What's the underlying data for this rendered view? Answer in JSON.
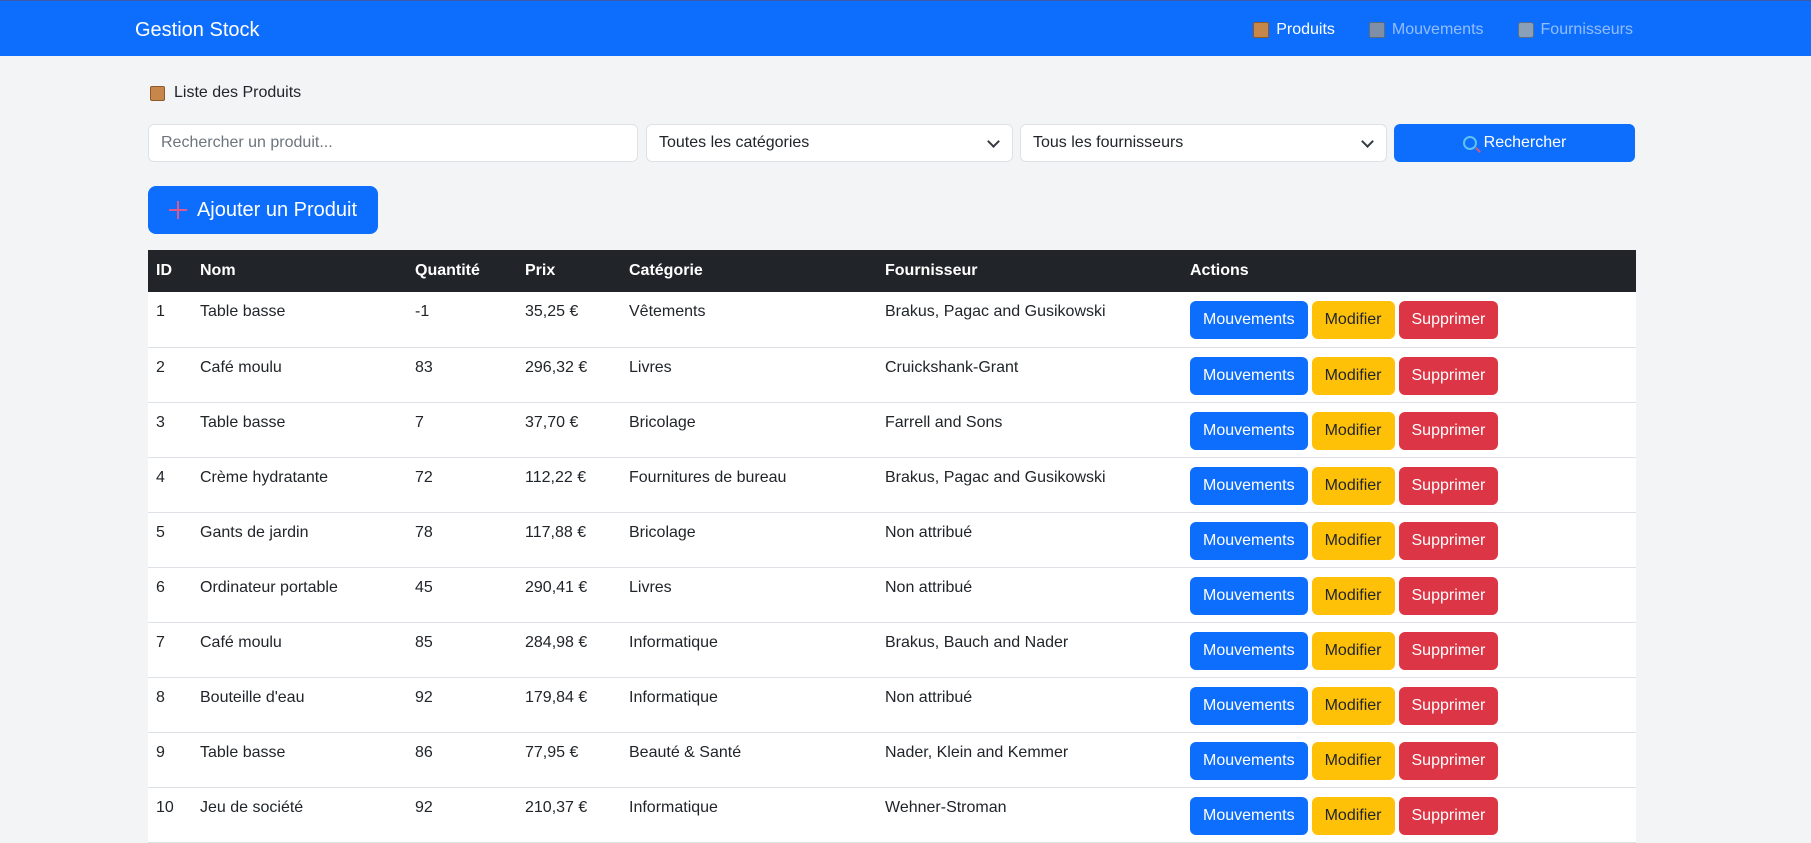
{
  "navbar": {
    "brand": "Gestion Stock",
    "links": [
      {
        "label": "Produits",
        "icon": "box-icon",
        "active": true
      },
      {
        "label": "Mouvements",
        "icon": "ledger-icon",
        "active": false
      },
      {
        "label": "Fournisseurs",
        "icon": "truck-icon",
        "active": false
      }
    ]
  },
  "page": {
    "title": "Liste des Produits"
  },
  "filters": {
    "search_placeholder": "Rechercher un produit...",
    "category_selected": "Toutes les catégories",
    "supplier_selected": "Tous les fournisseurs",
    "search_button": "Rechercher"
  },
  "add_button": "Ajouter un Produit",
  "table": {
    "headers": [
      "ID",
      "Nom",
      "Quantité",
      "Prix",
      "Catégorie",
      "Fournisseur",
      "Actions"
    ],
    "actions": {
      "move": "Mouvements",
      "edit": "Modifier",
      "delete": "Supprimer"
    },
    "rows": [
      [
        "1",
        "Table basse",
        "-1",
        "35,25 €",
        "Vêtements",
        "Brakus, Pagac and Gusikowski"
      ],
      [
        "2",
        "Café moulu",
        "83",
        "296,32 €",
        "Livres",
        "Cruickshank-Grant"
      ],
      [
        "3",
        "Table basse",
        "7",
        "37,70 €",
        "Bricolage",
        "Farrell and Sons"
      ],
      [
        "4",
        "Crème hydratante",
        "72",
        "112,22 €",
        "Fournitures de bureau",
        "Brakus, Pagac and Gusikowski"
      ],
      [
        "5",
        "Gants de jardin",
        "78",
        "117,88 €",
        "Bricolage",
        "Non attribué"
      ],
      [
        "6",
        "Ordinateur portable",
        "45",
        "290,41 €",
        "Livres",
        "Non attribué"
      ],
      [
        "7",
        "Café moulu",
        "85",
        "284,98 €",
        "Informatique",
        "Brakus, Bauch and Nader"
      ],
      [
        "8",
        "Bouteille d'eau",
        "92",
        "179,84 €",
        "Informatique",
        "Non attribué"
      ],
      [
        "9",
        "Table basse",
        "86",
        "77,95 €",
        "Beauté & Santé",
        "Nader, Klein and Kemmer"
      ],
      [
        "10",
        "Jeu de société",
        "92",
        "210,37 €",
        "Informatique",
        "Wehner-Stroman"
      ]
    ]
  },
  "colors": {
    "primary": "#0d6efd",
    "warning": "#ffc107",
    "danger": "#dc3545",
    "dark": "#212529"
  }
}
